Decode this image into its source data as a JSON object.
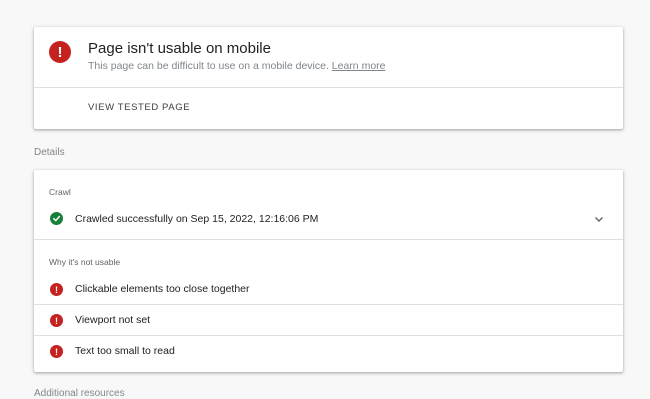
{
  "summary": {
    "title": "Page isn't usable on mobile",
    "subtitle": "This page can be difficult to use on a mobile device.",
    "learn_more": "Learn more",
    "view_tested": "VIEW TESTED PAGE",
    "status_icon": "error-icon"
  },
  "details": {
    "label": "Details",
    "crawl_label": "Crawl",
    "crawl_status": "Crawled successfully on Sep 15, 2022, 12:16:06 PM",
    "crawl_icon": "check-circle-icon",
    "why_label": "Why it's not usable",
    "issues": [
      "Clickable elements too close together",
      "Viewport not set",
      "Text too small to read"
    ]
  },
  "additional": {
    "label": "Additional resources"
  },
  "colors": {
    "error": "#c5221f",
    "success": "#188038"
  }
}
